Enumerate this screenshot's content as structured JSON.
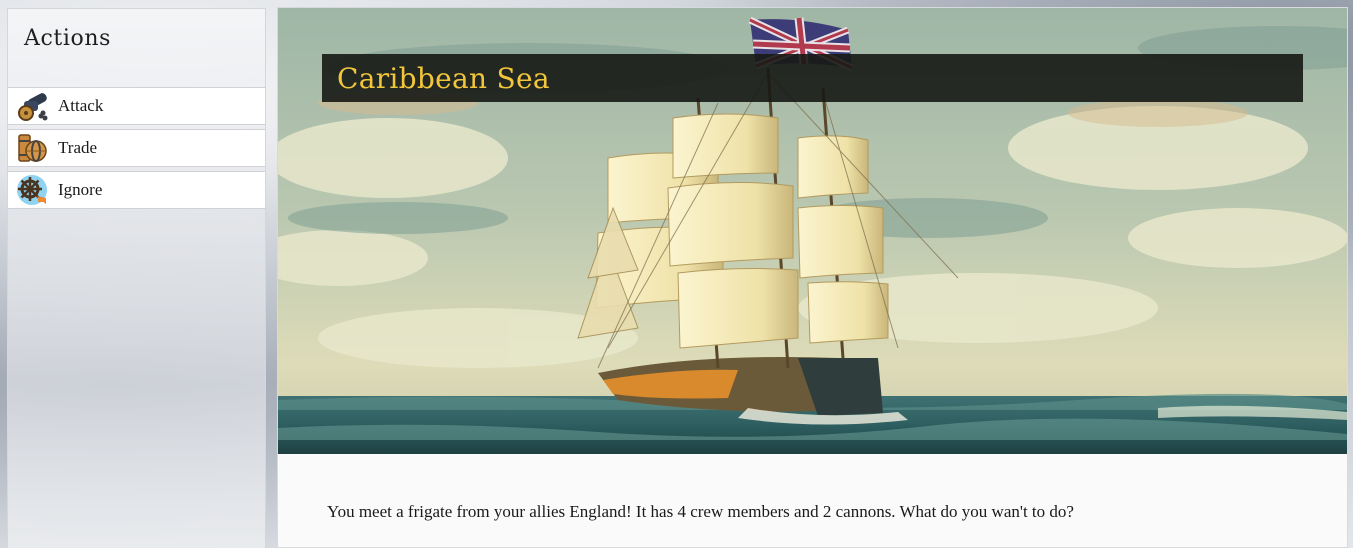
{
  "sidebar": {
    "title": "Actions",
    "actions": [
      {
        "label": "Attack",
        "icon": "cannon-icon"
      },
      {
        "label": "Trade",
        "icon": "barrel-icon"
      },
      {
        "label": "Ignore",
        "icon": "ship-wheel-icon"
      }
    ]
  },
  "scene": {
    "location": "Caribbean Sea",
    "image": "frigate-painting",
    "flag": "union-jack-flag"
  },
  "encounter": {
    "text": "You meet a frigate from your allies England! It has 4 crew members and 2 cannons. What do you wan't to do?"
  },
  "colors": {
    "title_accent": "#f2c63a",
    "banner_bg": "#16180f",
    "panel_bg": "#fafafb"
  }
}
